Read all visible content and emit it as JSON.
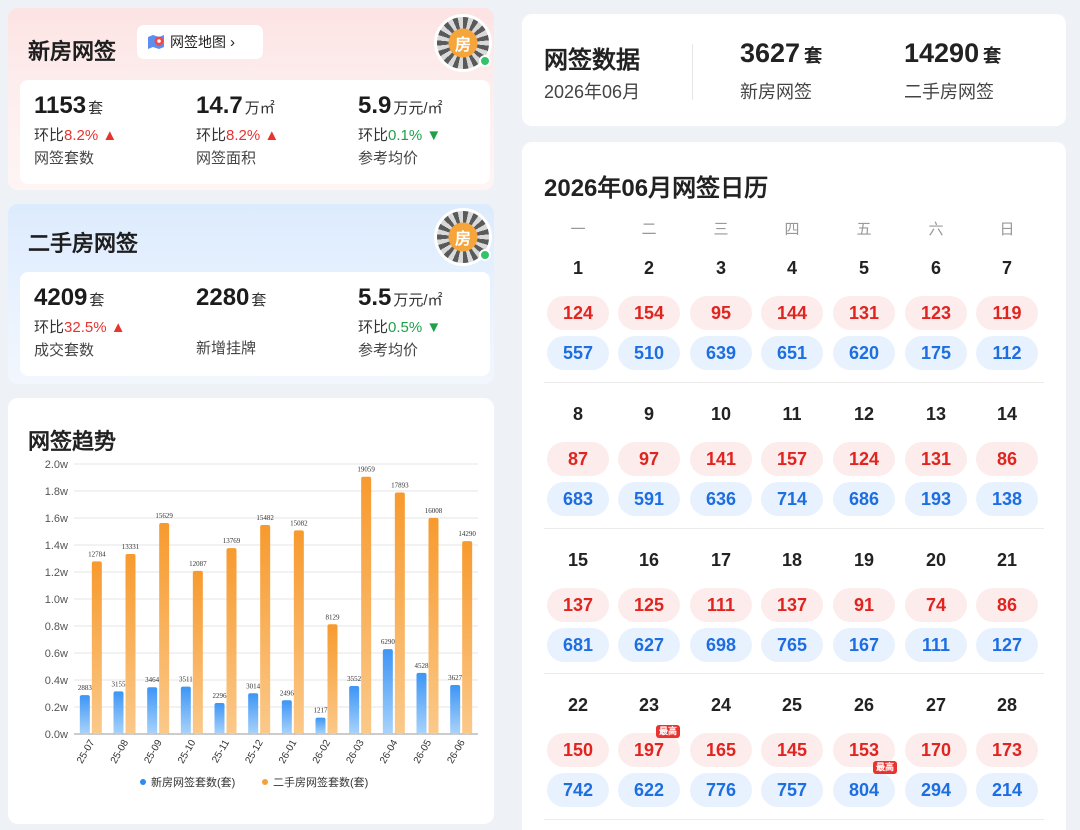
{
  "new_house": {
    "title": "新房网签",
    "map_button": "网签地图",
    "qr_char": "房",
    "stats": [
      {
        "value": "1153",
        "unit": "套",
        "change_label": "环比",
        "change": "8.2%",
        "direction": "up",
        "label": "网签套数"
      },
      {
        "value": "14.7",
        "unit": "万㎡",
        "change_label": "环比",
        "change": "8.2%",
        "direction": "up",
        "label": "网签面积"
      },
      {
        "value": "5.9",
        "unit": "万元/㎡",
        "change_label": "环比",
        "change": "0.1%",
        "direction": "down",
        "label": "参考均价"
      }
    ]
  },
  "second_house": {
    "title": "二手房网签",
    "qr_char": "房",
    "stats": [
      {
        "value": "4209",
        "unit": "套",
        "change_label": "环比",
        "change": "32.5%",
        "direction": "up",
        "label": "成交套数"
      },
      {
        "value": "2280",
        "unit": "套",
        "change_label": "",
        "change": "",
        "direction": "",
        "label": "新增挂牌"
      },
      {
        "value": "5.5",
        "unit": "万元/㎡",
        "change_label": "环比",
        "change": "0.5%",
        "direction": "down",
        "label": "参考均价"
      }
    ]
  },
  "trend": {
    "title": "网签趋势"
  },
  "chart_data": {
    "type": "bar",
    "categories": [
      "25-07",
      "25-08",
      "25-09",
      "25-10",
      "25-11",
      "25-12",
      "26-01",
      "26-02",
      "26-03",
      "26-04",
      "26-05",
      "26-06"
    ],
    "series": [
      {
        "name": "新房网签套数(套)",
        "color": "#2a8cf0",
        "values": [
          2883,
          3155,
          3464,
          3511,
          2296,
          3014,
          2496,
          1217,
          3552,
          6290,
          4528,
          3627
        ]
      },
      {
        "name": "二手房网签套数(套)",
        "color": "#f7a039",
        "values": [
          12784,
          13331,
          15629,
          12087,
          13769,
          15482,
          15082,
          8129,
          19059,
          17893,
          16008,
          14290
        ]
      }
    ],
    "y_ticks": [
      "0.0w",
      "0.2w",
      "0.4w",
      "0.6w",
      "0.8w",
      "1.0w",
      "1.2w",
      "1.4w",
      "1.6w",
      "1.8w",
      "2.0w"
    ],
    "ylim": [
      0,
      20000
    ],
    "legend": "bottom",
    "grid": true
  },
  "summary": {
    "title": "网签数据",
    "month": "2026年06月",
    "new_value": "3627",
    "new_unit": "套",
    "new_label": "新房网签",
    "second_value": "14290",
    "second_unit": "套",
    "second_label": "二手房网签"
  },
  "calendar": {
    "title": "2026年06月网签日历",
    "weekdays": [
      "一",
      "二",
      "三",
      "四",
      "五",
      "六",
      "日"
    ],
    "peak_tag": "最高",
    "days": [
      {
        "d": "1",
        "new": "124",
        "second": "557"
      },
      {
        "d": "2",
        "new": "154",
        "second": "510"
      },
      {
        "d": "3",
        "new": "95",
        "second": "639"
      },
      {
        "d": "4",
        "new": "144",
        "second": "651"
      },
      {
        "d": "5",
        "new": "131",
        "second": "620"
      },
      {
        "d": "6",
        "new": "123",
        "second": "175"
      },
      {
        "d": "7",
        "new": "119",
        "second": "112"
      },
      {
        "d": "8",
        "new": "87",
        "second": "683"
      },
      {
        "d": "9",
        "new": "97",
        "second": "591"
      },
      {
        "d": "10",
        "new": "141",
        "second": "636"
      },
      {
        "d": "11",
        "new": "157",
        "second": "714"
      },
      {
        "d": "12",
        "new": "124",
        "second": "686"
      },
      {
        "d": "13",
        "new": "131",
        "second": "193"
      },
      {
        "d": "14",
        "new": "86",
        "second": "138"
      },
      {
        "d": "15",
        "new": "137",
        "second": "681"
      },
      {
        "d": "16",
        "new": "125",
        "second": "627"
      },
      {
        "d": "17",
        "new": "111",
        "second": "698"
      },
      {
        "d": "18",
        "new": "137",
        "second": "765"
      },
      {
        "d": "19",
        "new": "91",
        "second": "167"
      },
      {
        "d": "20",
        "new": "74",
        "second": "111"
      },
      {
        "d": "21",
        "new": "86",
        "second": "127"
      },
      {
        "d": "22",
        "new": "150",
        "second": "742"
      },
      {
        "d": "23",
        "new": "197",
        "second": "622",
        "new_peak": true
      },
      {
        "d": "24",
        "new": "165",
        "second": "776"
      },
      {
        "d": "25",
        "new": "145",
        "second": "757"
      },
      {
        "d": "26",
        "new": "153",
        "second": "804",
        "second_peak": true
      },
      {
        "d": "27",
        "new": "170",
        "second": "294"
      },
      {
        "d": "28",
        "new": "173",
        "second": "214"
      }
    ]
  }
}
